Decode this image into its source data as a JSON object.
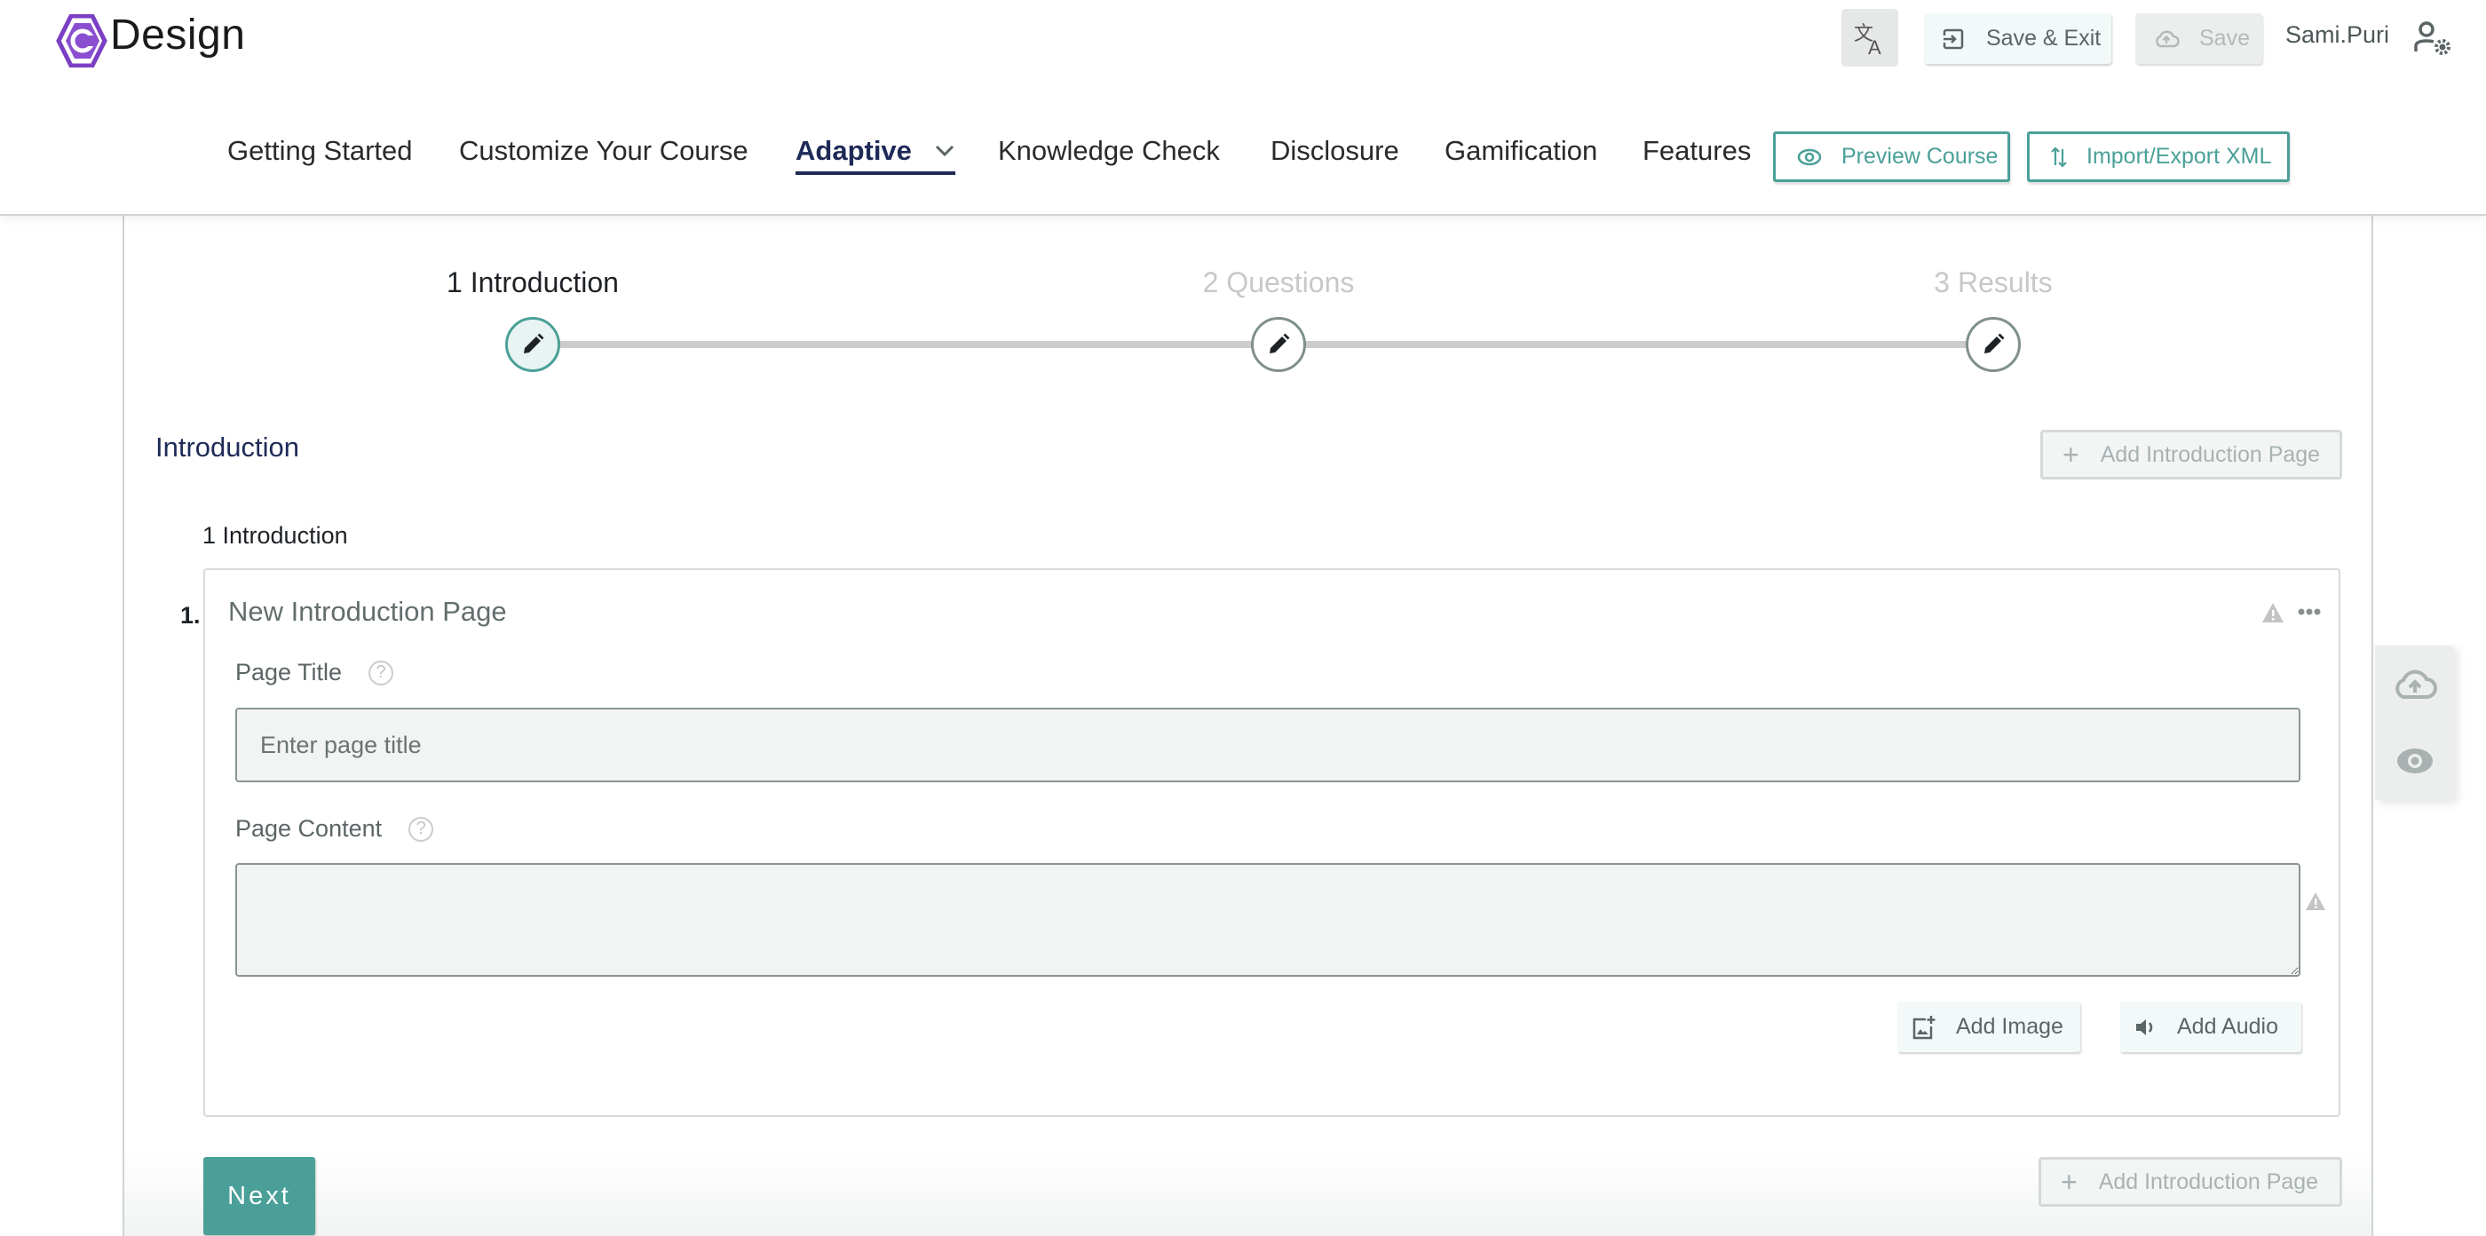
{
  "app": {
    "logo_text": "Design",
    "user_name": "Sami.Puri"
  },
  "toolbar": {
    "translate_icon": "translate-icon",
    "save_exit_label": "Save & Exit",
    "save_label": "Save",
    "user_settings_icon": "user-settings-icon"
  },
  "nav": {
    "items": [
      {
        "label": "Getting Started"
      },
      {
        "label": "Customize Your Course"
      },
      {
        "label": "Adaptive",
        "active": true
      },
      {
        "label": "Knowledge Check"
      },
      {
        "label": "Disclosure"
      },
      {
        "label": "Gamification"
      },
      {
        "label": "Features"
      }
    ],
    "preview_label": "Preview Course",
    "import_export_label": "Import/Export XML"
  },
  "stepper": {
    "steps": [
      {
        "label": "1 Introduction",
        "active": true
      },
      {
        "label": "2 Questions",
        "active": false
      },
      {
        "label": "3 Results",
        "active": false
      }
    ]
  },
  "section": {
    "title": "Introduction",
    "add_page_label": "Add Introduction Page",
    "sub_title": "1 Introduction"
  },
  "card": {
    "number": "1.",
    "title": "New Introduction Page",
    "page_title_label": "Page Title",
    "page_title_placeholder": "Enter page title",
    "page_title_value": "",
    "page_content_label": "Page Content",
    "page_content_value": "",
    "add_image_label": "Add Image",
    "add_audio_label": "Add Audio",
    "help_glyph": "?"
  },
  "footer": {
    "next_label": "Next",
    "add_page_label": "Add Introduction Page"
  },
  "colors": {
    "accent": "#4aa098",
    "navy": "#1e2a57",
    "logo_purple": "#7b3fc4"
  }
}
